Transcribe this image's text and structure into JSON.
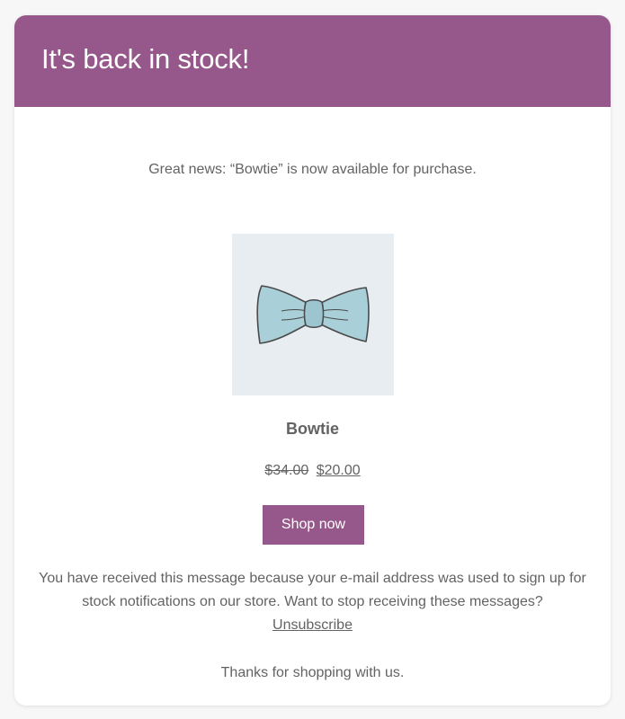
{
  "header": {
    "title": "It's back in stock!",
    "background_color": "#96588a"
  },
  "intro": {
    "text": "Great news: “Bowtie” is now available for purchase."
  },
  "product": {
    "image_icon": "bowtie-image",
    "name": "Bowtie",
    "old_price": "$34.00",
    "new_price": "$20.00"
  },
  "cta": {
    "label": "Shop now",
    "color": "#96588a"
  },
  "notice": {
    "text": "You have received this message because your e-mail address was used to sign up for stock notifications on our store. Want to stop receiving these messages?",
    "unsubscribe_label": "Unsubscribe"
  },
  "footer": {
    "thanks": "Thanks for shopping with us."
  }
}
